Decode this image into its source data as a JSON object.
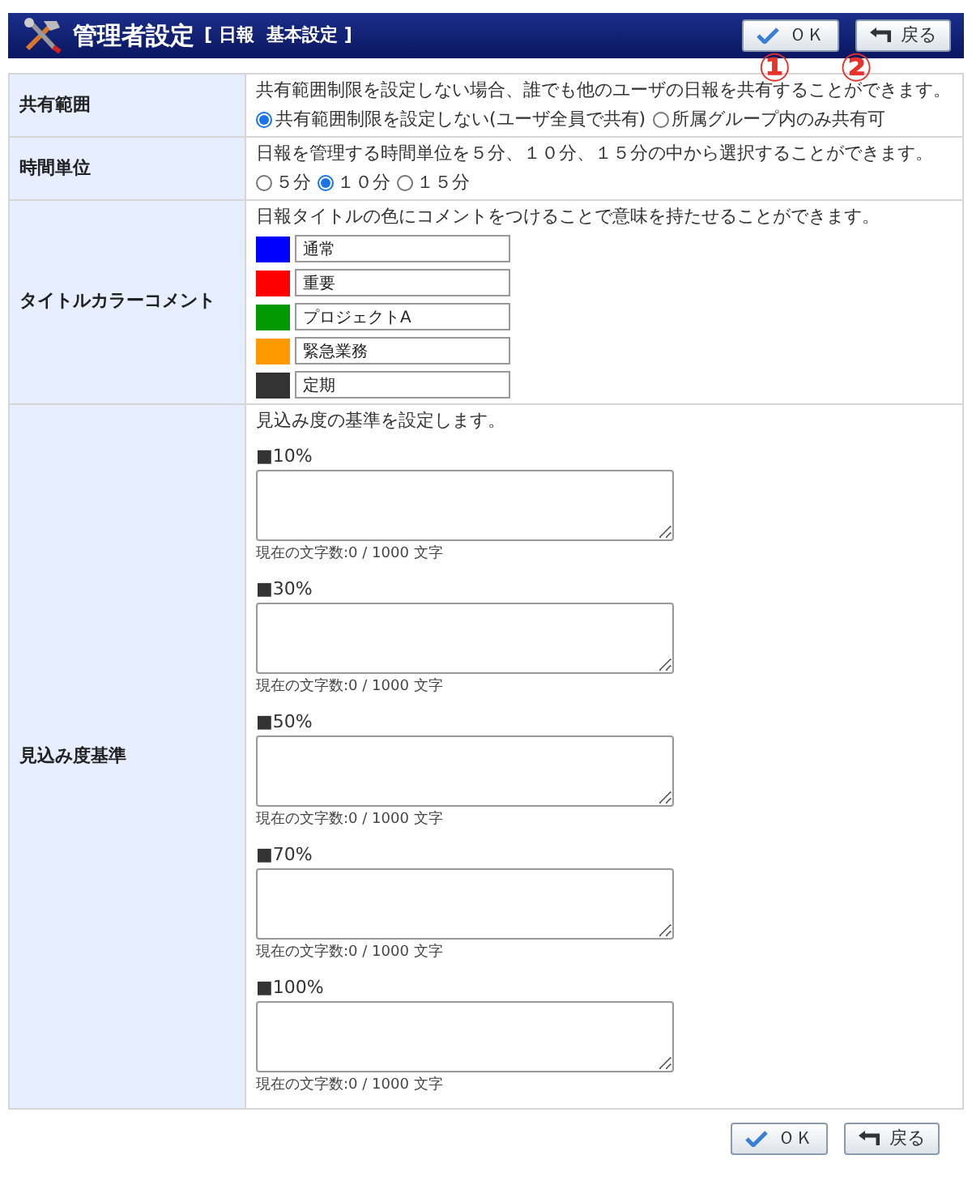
{
  "header": {
    "title": "管理者設定",
    "subtitle": "[ 日報  基本設定 ]"
  },
  "top_buttons": [
    {
      "kind": "ok",
      "label": "ＯＫ"
    },
    {
      "kind": "back",
      "label": "戻る"
    }
  ],
  "markers": [
    "①",
    "②"
  ],
  "share": {
    "label": "共有範囲",
    "description": "共有範囲制限を設定しない場合、誰でも他のユーザの日報を共有することができます。",
    "options": [
      {
        "label": "共有範囲制限を設定しない(ユーザ全員で共有)",
        "selected": true
      },
      {
        "label": "所属グループ内のみ共有可",
        "selected": false
      }
    ]
  },
  "time_unit": {
    "label": "時間単位",
    "description": "日報を管理する時間単位を５分、１０分、１５分の中から選択することができます。",
    "options": [
      {
        "label": "５分",
        "selected": false
      },
      {
        "label": "１０分",
        "selected": true
      },
      {
        "label": "１５分",
        "selected": false
      }
    ]
  },
  "title_colors": {
    "label": "タイトルカラーコメント",
    "description": "日報タイトルの色にコメントをつけることで意味を持たせることができます。",
    "items": [
      {
        "color": "#0000ff",
        "value": "通常"
      },
      {
        "color": "#ff0000",
        "value": "重要"
      },
      {
        "color": "#009900",
        "value": "プロジェクトA"
      },
      {
        "color": "#ff9900",
        "value": "緊急業務"
      },
      {
        "color": "#333333",
        "value": "定期"
      }
    ]
  },
  "probability": {
    "label": "見込み度基準",
    "description": "見込み度の基準を設定します。",
    "levels": [
      {
        "label": "■10%",
        "counter": "現在の文字数:0 / 1000 文字"
      },
      {
        "label": "■30%",
        "counter": "現在の文字数:0 / 1000 文字"
      },
      {
        "label": "■50%",
        "counter": "現在の文字数:0 / 1000 文字"
      },
      {
        "label": "■70%",
        "counter": "現在の文字数:0 / 1000 文字"
      },
      {
        "label": "■100%",
        "counter": "現在の文字数:0 / 1000 文字"
      }
    ]
  },
  "bottom_buttons": [
    {
      "kind": "ok",
      "label": "ＯＫ"
    },
    {
      "kind": "back",
      "label": "戻る"
    }
  ]
}
